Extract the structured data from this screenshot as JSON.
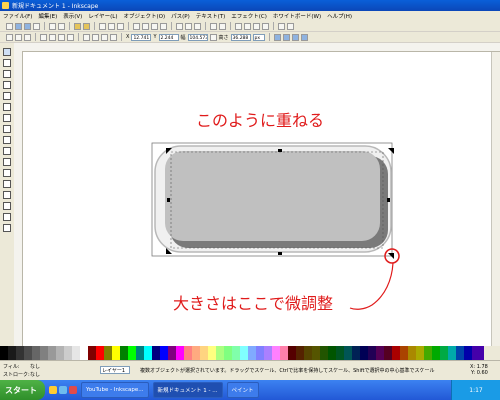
{
  "window": {
    "title": "新規ドキュメント 1 - Inkscape"
  },
  "menu": [
    "ファイル(F)",
    "編集(E)",
    "表示(V)",
    "レイヤー(L)",
    "オブジェクト(O)",
    "パス(P)",
    "テキスト(T)",
    "エフェクト(C)",
    "ホワイトボード(W)",
    "ヘルプ(H)"
  ],
  "toolbar2": {
    "x_label": "X",
    "x_value": "12.741",
    "y_label": "Y",
    "y_value": "2.244",
    "w_label": "幅",
    "w_value": "104.573",
    "h_label": "高さ",
    "h_value": "36.288",
    "unit": "px"
  },
  "annotations": {
    "top": "このように重ねる",
    "bottom": "大きさはここで微調整"
  },
  "status": {
    "fill_label": "フィル:",
    "stroke_label": "ストローク:",
    "fill_value": "なし",
    "stroke_value": "なし",
    "layer": "レイヤー1",
    "message": "複数オブジェクトが選択されています。ドラッグでスケール、Ctrlで比率を保持してスケール、Shiftで選択中の中心基準でスケール",
    "x_label": "X:",
    "x_value": "1.78",
    "y_label": "Y:",
    "y_value": "0.60"
  },
  "taskbar": {
    "start": "スタート",
    "tasks": [
      "YouTube - Inkscape...",
      "新規ドキュメント 1 - ...",
      "ペイント"
    ],
    "clock": "1:17"
  },
  "colors": {
    "accent": "#e01b1b",
    "shape_fill": "#c0c0c0",
    "shape_shadow": "#7a7a7a"
  }
}
